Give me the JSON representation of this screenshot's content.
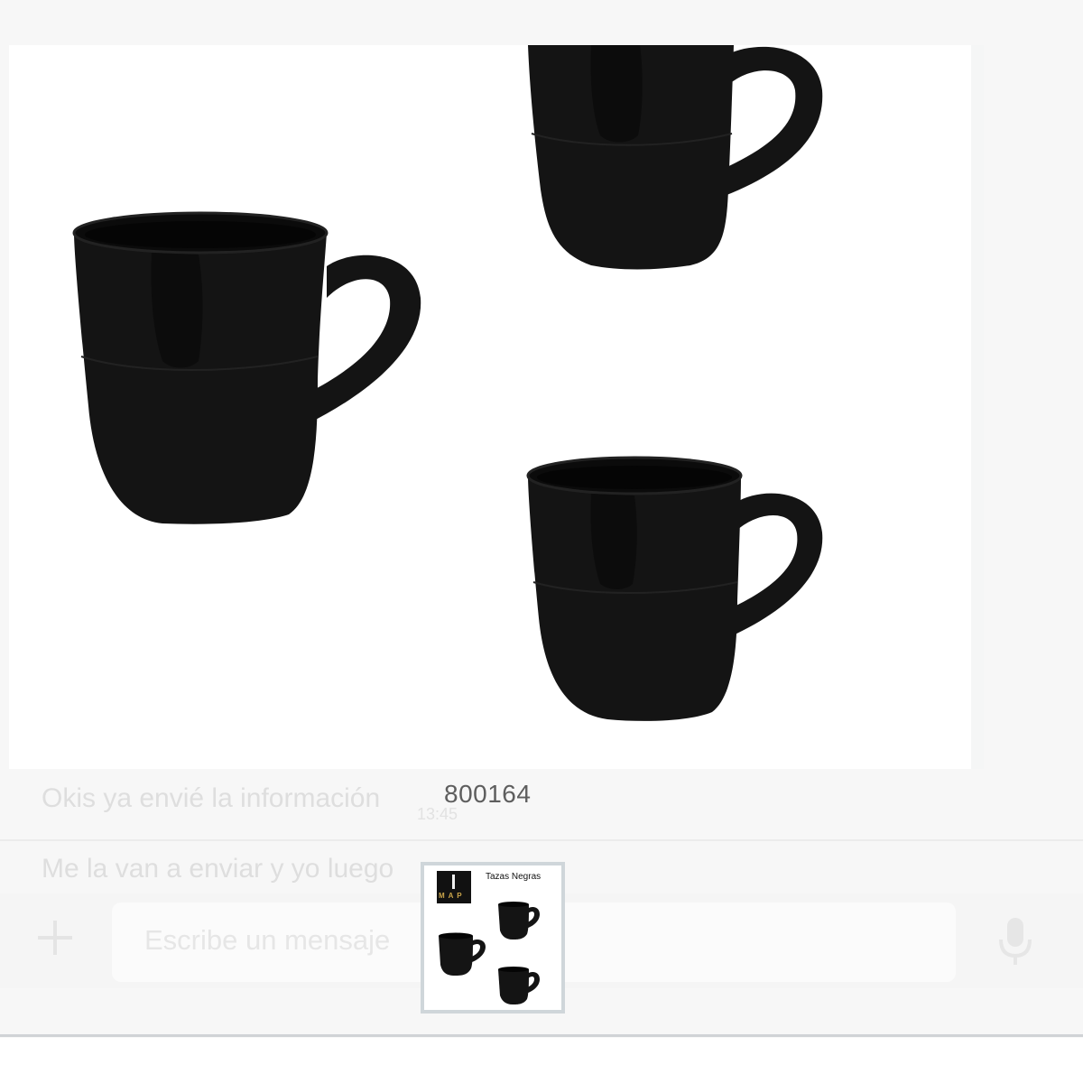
{
  "chat": {
    "messages": [
      {
        "text": "Okis ya envié la información",
        "time": "13:45"
      },
      {
        "text": "Me la van a enviar y yo luego"
      }
    ],
    "composer": {
      "placeholder": "Escribe un mensaje"
    }
  },
  "viewer": {
    "product_code": "800164",
    "thumbnail": {
      "logo_text": "M A P",
      "title": "Tazas Negras"
    }
  },
  "icons": {
    "attach": "plus-icon",
    "voice": "microphone-icon"
  },
  "colors": {
    "mug": "#141414",
    "thumb_border": "#cfd6da",
    "logo_accent": "#c9a44a"
  }
}
